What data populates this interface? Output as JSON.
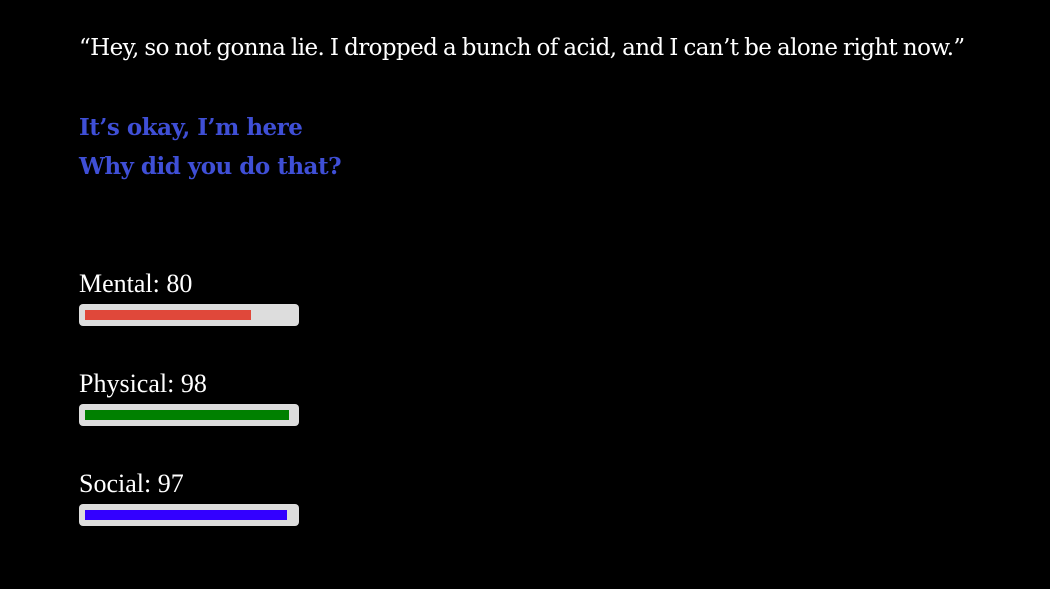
{
  "dialogue": {
    "text": "“Hey, so not gonna lie. I dropped a bunch of acid, and I can’t be alone right now.”"
  },
  "choices": [
    {
      "label": "It’s okay, I’m here"
    },
    {
      "label": "Why did you do that?"
    }
  ],
  "choice_color": "#3f4fd6",
  "stats": [
    {
      "label": "Mental: 80",
      "value": 80,
      "max": 100,
      "color": "#e0483a"
    },
    {
      "label": "Physical: 98",
      "value": 98,
      "max": 100,
      "color": "#008000"
    },
    {
      "label": "Social: 97",
      "value": 97,
      "max": 100,
      "color": "#3300ff"
    }
  ]
}
